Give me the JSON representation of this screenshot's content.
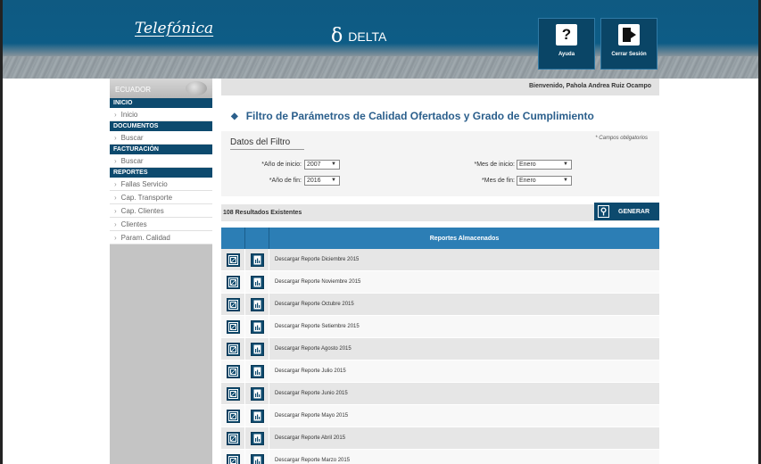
{
  "header": {
    "brand": "Telefónica",
    "app_name": "DELTA",
    "help_label": "Ayuda",
    "logout_label": "Cerrar Sesión"
  },
  "sidebar": {
    "country": "ECUADOR",
    "sections": [
      {
        "title": "INICIO",
        "items": [
          "Inicio"
        ]
      },
      {
        "title": "DOCUMENTOS",
        "items": [
          "Buscar"
        ]
      },
      {
        "title": "FACTURACIÓN",
        "items": [
          "Buscar"
        ]
      },
      {
        "title": "REPORTES",
        "items": [
          "Fallas Servicio",
          "Cap. Transporte",
          "Cap. Clientes",
          "Clientes",
          "Param. Calidad"
        ]
      }
    ]
  },
  "main": {
    "welcome": "Bienvenido, Pahola Andrea Ruiz Ocampo",
    "title": "Filtro de Parámetros de Calidad Ofertados y Grado de Cumplimiento",
    "filter": {
      "title": "Datos del Filtro",
      "required_note": "* Campos obligatorios",
      "start_year_label": "*Año de inicio:",
      "start_year_value": "2007",
      "end_year_label": "*Año de fin:",
      "end_year_value": "2016",
      "start_month_label": "*Mes de inicio:",
      "start_month_value": "Enero",
      "end_month_label": "*Mes de fin:",
      "end_month_value": "Enero"
    },
    "results_count": "108 Resultados Existentes",
    "generate_label": "GENERAR",
    "table": {
      "header": "Reportes Almacenados",
      "rows": [
        "Descargar Reporte Diciembre 2015",
        "Descargar Reporte Noviembre 2015",
        "Descargar Reporte Octubre 2015",
        "Descargar Reporte Setiembre 2015",
        "Descargar Reporte Agosto 2015",
        "Descargar Reporte Julio 2015",
        "Descargar Reporte Junio 2015",
        "Descargar Reporte Mayo 2015",
        "Descargar Reporte Abril 2015",
        "Descargar Reporte Marzo 2015"
      ]
    }
  },
  "colors": {
    "header_blue": "#0f5a82",
    "nav_dark": "#0d4a6e",
    "table_header": "#2c7eb5",
    "title_blue": "#2b5f8c"
  },
  "icons": {
    "help": "question-icon",
    "logout": "logout-icon",
    "generate": "search-icon",
    "row_pdf": "pdf-icon",
    "row_excel": "excel-icon"
  }
}
